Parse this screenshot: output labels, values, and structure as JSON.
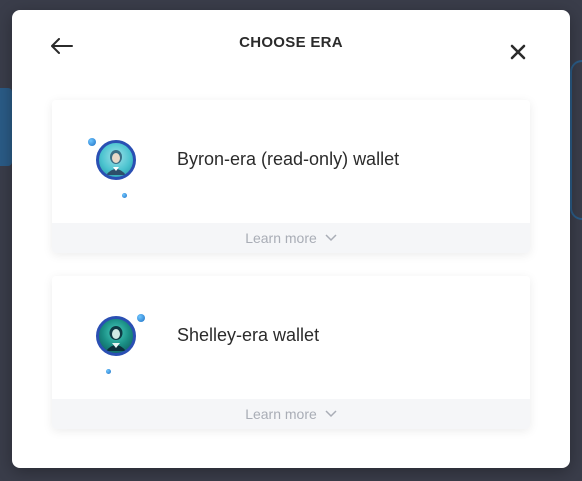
{
  "modal": {
    "title": "CHOOSE ERA",
    "icons": {
      "back": "arrow-left-icon",
      "close": "close-icon"
    }
  },
  "options": [
    {
      "label": "Byron-era (read-only) wallet",
      "learn_more": "Learn more",
      "icon": "byron-portrait-icon"
    },
    {
      "label": "Shelley-era wallet",
      "learn_more": "Learn more",
      "icon": "shelley-portrait-icon"
    }
  ],
  "colors": {
    "backdrop": "#3a3d4a",
    "modal_bg": "#ffffff",
    "card_footer_bg": "#f5f6f8",
    "text_primary": "#2b2b2b",
    "text_muted": "#a9adb6",
    "portrait_ring": "#2a4fb3"
  }
}
